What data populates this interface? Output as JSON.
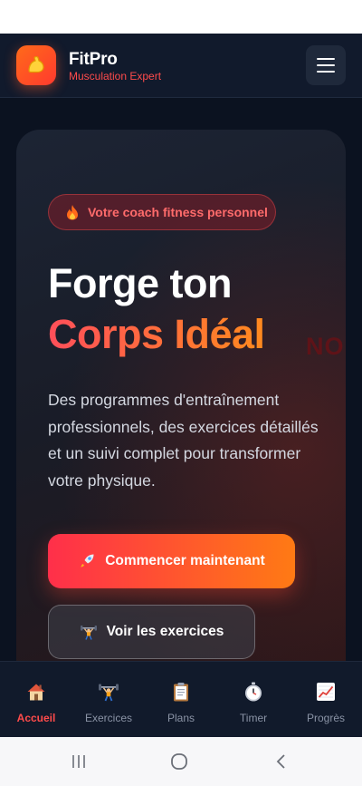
{
  "app": {
    "title": "FitPro",
    "subtitle": "Musculation Expert",
    "brand_color": "#ff4b4b",
    "accent_gradient": [
      "#ff2f4a",
      "#ff7a14"
    ]
  },
  "header": {
    "logo_icon": "flexed-bicep-icon",
    "menu_icon": "hamburger-menu-icon"
  },
  "hero": {
    "badge_icon": "fire-icon",
    "badge_label": "Votre coach fitness personnel",
    "headline_line1": "Forge ton",
    "headline_line2": "Corps Idéal",
    "description": "Des programmes d'entraînement professionnels, des exercices détaillés et un suivi complet pour transformer votre physique.",
    "primary_cta": {
      "icon": "rocket-icon",
      "label": "Commencer maintenant"
    },
    "secondary_cta": {
      "icon": "weightlifter-icon",
      "label": "Voir les exercices"
    },
    "background_text": [
      "NO E"
    ]
  },
  "bottom_nav": {
    "items": [
      {
        "label": "Accueil",
        "icon": "house-icon",
        "active": true
      },
      {
        "label": "Exercices",
        "icon": "weightlifter-icon",
        "active": false
      },
      {
        "label": "Plans",
        "icon": "clipboard-icon",
        "active": false
      },
      {
        "label": "Timer",
        "icon": "stopwatch-icon",
        "active": false
      },
      {
        "label": "Progrès",
        "icon": "chart-increasing-icon",
        "active": false
      }
    ]
  },
  "system_nav": {
    "recents_icon": "recent-apps-icon",
    "home_icon": "home-circle-icon",
    "back_icon": "back-chevron-icon"
  }
}
